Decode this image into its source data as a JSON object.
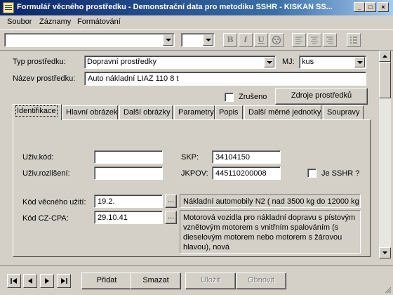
{
  "window": {
    "title": "Formulář věcného prostředku - Demonstrační data pro metodiku SSHR - KISKAN SS...",
    "controls": [
      "_",
      "□",
      "×"
    ]
  },
  "menu": [
    {
      "label": "Soubor"
    },
    {
      "label": "Záznamy"
    },
    {
      "label": "Formátování"
    }
  ],
  "toolbar": {
    "font_value": "",
    "size_value": "",
    "buttons": [
      "B",
      "I",
      "U"
    ]
  },
  "form": {
    "typ_label": "Typ prostředku:",
    "typ_value": "Dopravní prostředky",
    "mj_label": "MJ:",
    "mj_value": "kus",
    "nazev_label": "Název prostředku:",
    "nazev_value": "Auto nákladní LIAZ 110  8 t",
    "zruseno_label": "Zrušeno",
    "zdroje_button": "Zdroje prostředků"
  },
  "tabs": [
    {
      "label": "Identifikace",
      "active": true
    },
    {
      "label": "Hlavní obrázek"
    },
    {
      "label": "Další obrázky"
    },
    {
      "label": "Parametry"
    },
    {
      "label": "Popis"
    },
    {
      "label": "Další měrné jednotky"
    },
    {
      "label": "Soupravy"
    }
  ],
  "identifikace": {
    "uziv_kod_label": "Uživ.kód:",
    "uziv_kod_value": "",
    "uziv_rozliseni_label": "Uživ.rozlišení:",
    "uziv_rozliseni_value": "",
    "skp_label": "SKP:",
    "skp_value": "34104150",
    "jkpov_label": "JKPOV:",
    "jkpov_value": "445110200008",
    "je_sshr_label": "Je SSHR ?",
    "kod_uziti_label": "Kód věcného užití:",
    "kod_uziti_value": "19.2.",
    "kod_uziti_desc": "Nákladní automobily N2 ( nad 3500 kg  do 12000 kg",
    "kod_czcpa_label": "Kód CZ-CPA:",
    "kod_czcpa_value": "29.10.41",
    "kod_czcpa_desc": "Motorová vozidla pro nákladní dopravu s pístovým vznětovým motorem s vnitřním spalováním (s dieselovým motorem nebo motorem s žárovou hlavou), nová",
    "lookup_label": "..."
  },
  "bottom": {
    "pridat": "Přidat",
    "smazat": "Smazat",
    "ulozit": "Uložit",
    "obnovit": "Obnovit"
  }
}
